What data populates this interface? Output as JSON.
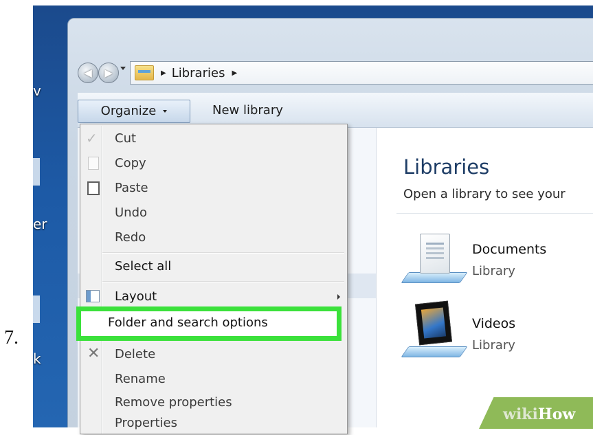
{
  "step_number": "7.",
  "desktop": {
    "fragments": [
      "v",
      "er",
      "k"
    ]
  },
  "address_bar": {
    "crumbs": [
      "Libraries"
    ]
  },
  "toolbar": {
    "organize_label": "Organize",
    "new_library_label": "New library"
  },
  "organize_menu": {
    "items": [
      {
        "label": "Cut",
        "icon": "cut-icon"
      },
      {
        "label": "Copy",
        "icon": "copy-icon"
      },
      {
        "label": "Paste",
        "icon": "paste-icon"
      },
      {
        "label": "Undo"
      },
      {
        "label": "Redo"
      },
      {
        "label": "Select all"
      },
      {
        "label": "Layout",
        "icon": "layout-icon",
        "submenu": true
      },
      {
        "label": "Folder and search options",
        "highlighted": true
      },
      {
        "label": "Delete",
        "icon": "delete-icon"
      },
      {
        "label": "Rename"
      },
      {
        "label": "Remove properties"
      },
      {
        "label": "Properties"
      }
    ]
  },
  "main": {
    "title": "Libraries",
    "subtitle": "Open a library to see your",
    "libraries": [
      {
        "name": "Documents",
        "type": "Library"
      },
      {
        "name": "Videos",
        "type": "Library"
      }
    ]
  },
  "watermark": {
    "part1": "wiki",
    "part2": "How"
  },
  "colors": {
    "highlight": "#3be13b",
    "desktop": "#1d5aa6",
    "title": "#1e3d66",
    "watermark_bg": "#8fba58"
  }
}
